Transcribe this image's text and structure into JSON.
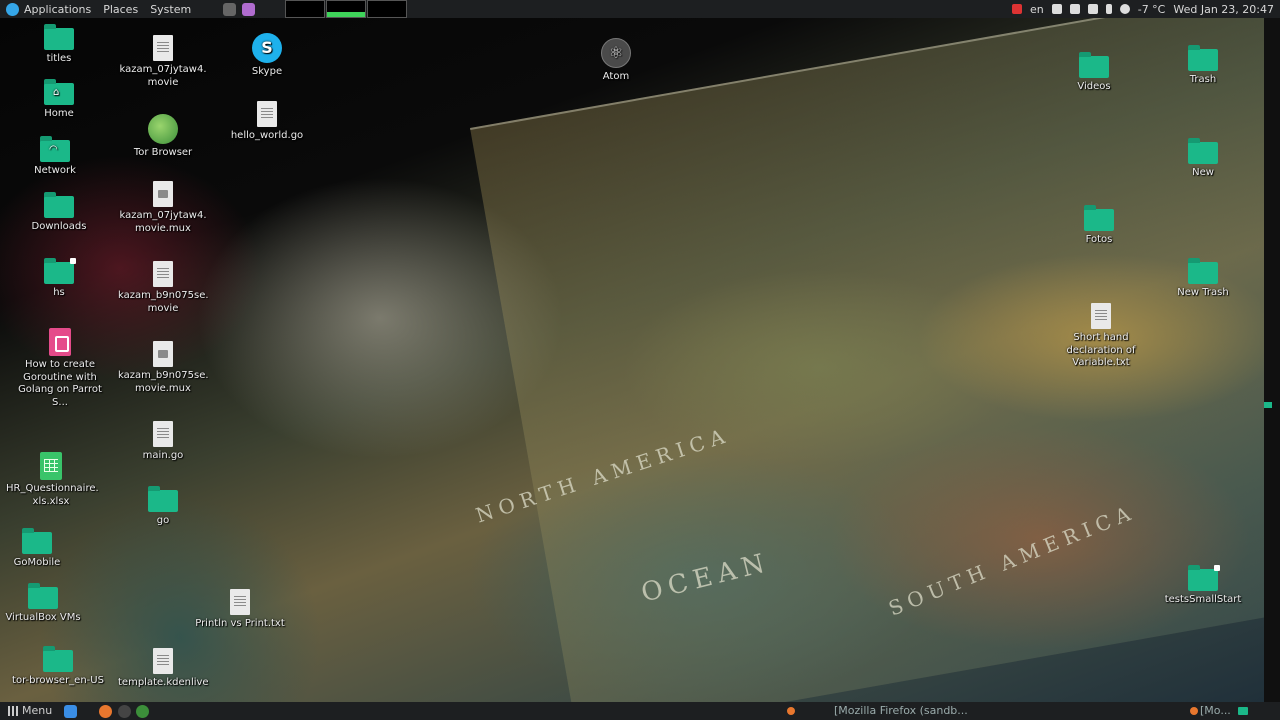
{
  "top_panel": {
    "menus": [
      "Applications",
      "Places",
      "System"
    ],
    "keyboard_layout": "en",
    "weather": "-7 °C",
    "datetime": "Wed Jan 23, 20:47"
  },
  "bottom_panel": {
    "menu_label": "Menu",
    "task_firefox": "[Mozilla Firefox (sandb...",
    "task_right": "[Mo..."
  },
  "desktop": {
    "titles": "titles",
    "home": "Home",
    "network": "Network",
    "downloads": "Downloads",
    "hs": "hs",
    "goroutine": "How to create Goroutine with Golang on Parrot S...",
    "hr": "HR_Questionnaire.\nxls.xlsx",
    "gomobile": "GoMobile",
    "virtualbox": "VirtualBox VMs",
    "torbrowser_folder": "tor-browser_en-US",
    "kazam1": "kazam_07jytaw4.\nmovie",
    "torbrowser": "Tor Browser",
    "kazam1mux": "kazam_07jytaw4.\nmovie.mux",
    "kazam2": "kazam_b9n075se.\nmovie",
    "kazam2mux": "kazam_b9n075se.\nmovie.mux",
    "maingo": "main.go",
    "go": "go",
    "println": "Println vs Print.txt",
    "template": "template.kdenlive",
    "skype": "Skype",
    "helloworld": "hello_world.go",
    "atom": "Atom",
    "videos": "Videos",
    "trash": "Trash",
    "new": "New",
    "fotos": "Fotos",
    "newtrash": "New Trash",
    "shorthand": "Short hand declaration of Variable.txt",
    "testssmallstart": "testsSmallStart"
  },
  "wallpaper_text": {
    "north_america": "NORTH AMERICA",
    "ocean": "OCEAN",
    "south_america": "SOUTH AMERICA"
  },
  "colors": {
    "folder": "#1bb889",
    "panel": "#1d1f21",
    "skype": "#1eb1ec"
  }
}
